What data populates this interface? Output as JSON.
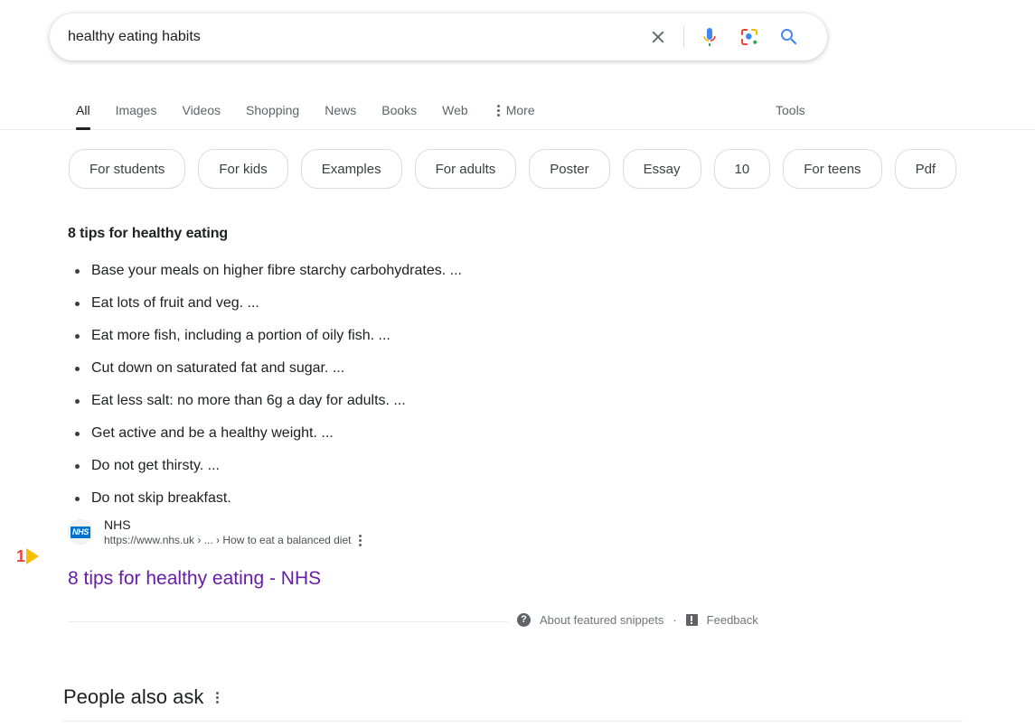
{
  "search": {
    "query": "healthy eating habits",
    "placeholder": "Search",
    "icons": {
      "clear": "close-icon",
      "voice": "microphone-icon",
      "lens": "google-lens-icon",
      "submit": "search-icon"
    }
  },
  "nav": {
    "tabs": [
      {
        "label": "All",
        "active": true
      },
      {
        "label": "Images",
        "active": false
      },
      {
        "label": "Videos",
        "active": false
      },
      {
        "label": "Shopping",
        "active": false
      },
      {
        "label": "News",
        "active": false
      },
      {
        "label": "Books",
        "active": false
      },
      {
        "label": "Web",
        "active": false
      }
    ],
    "more_label": "More",
    "tools_label": "Tools"
  },
  "chips": [
    {
      "label": "For students"
    },
    {
      "label": "For kids"
    },
    {
      "label": "Examples"
    },
    {
      "label": "For adults"
    },
    {
      "label": "Poster"
    },
    {
      "label": "Essay"
    },
    {
      "label": "10"
    },
    {
      "label": "For teens"
    },
    {
      "label": "Pdf"
    }
  ],
  "snippet": {
    "title": "8 tips for healthy eating",
    "items": [
      "Base your meals on higher fibre starchy carbohydrates. ...",
      "Eat lots of fruit and veg. ...",
      "Eat more fish, including a portion of oily fish. ...",
      "Cut down on saturated fat and sugar. ...",
      "Eat less salt: no more than 6g a day for adults. ...",
      "Get active and be a healthy weight. ...",
      "Do not get thirsty. ...",
      "Do not skip breakfast."
    ],
    "source": {
      "site_name": "NHS",
      "favicon_text": "NHS",
      "url": "https://www.nhs.uk › ... › How to eat a balanced diet"
    },
    "result_title": "8 tips for healthy eating - NHS",
    "footer": {
      "about_label": "About featured snippets",
      "separator": "·",
      "feedback_label": "Feedback"
    }
  },
  "annotation": {
    "number": "1",
    "number_color": "#e8453c",
    "arrow_color": "#fbbc04"
  },
  "people_also_ask": {
    "title": "People also ask"
  },
  "colors": {
    "link_visited": "#681da8",
    "text_primary": "#202124",
    "text_secondary": "#5f6368",
    "google_blue": "#4285f4",
    "google_red": "#ea4335",
    "google_yellow": "#fbbc04",
    "google_green": "#34a853",
    "nhs_blue": "#0072ce"
  }
}
